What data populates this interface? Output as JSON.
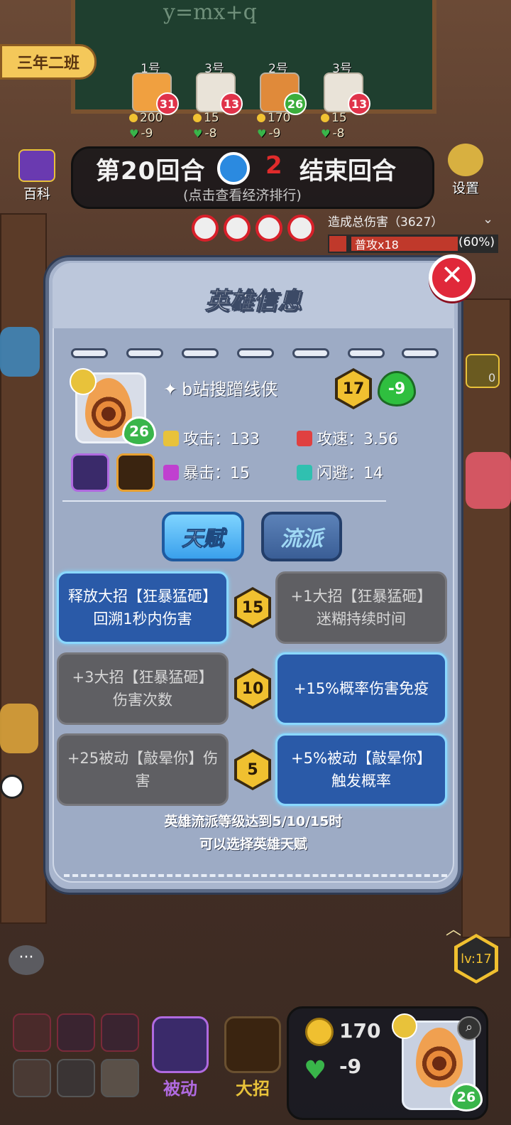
{
  "header": {
    "class_sign": "三年二班",
    "blackboard_text": "y=mx+q"
  },
  "players": [
    {
      "num": "1号",
      "level": "31",
      "gold": "200",
      "hp": "-9"
    },
    {
      "num": "3号",
      "level": "13",
      "gold": "15",
      "hp": "-8"
    },
    {
      "num": "2号",
      "level": "26",
      "gold": "170",
      "hp": "-9"
    },
    {
      "num": "3号",
      "level": "13",
      "gold": "15",
      "hp": "-8"
    }
  ],
  "round_bar": {
    "round_label": "第20回合",
    "countdown": "2",
    "end_label": "结束回合",
    "subtitle": "(点击查看经济排行)"
  },
  "side_buttons": {
    "encyclopedia": "百科",
    "settings": "设置"
  },
  "damage_panel": {
    "title": "造成总伤害（3627）",
    "row_label": "普攻x18",
    "row_pct": "(60%)",
    "right_value": "0"
  },
  "modal": {
    "title": "英雄信息",
    "hero": {
      "name": "b站搜蹭线侠",
      "level": "26",
      "star_level": "17",
      "health": "-9"
    },
    "stats": {
      "attack": "攻击：133",
      "attack_speed": "攻速：3.56",
      "crit": "暴击：15",
      "dodge": "闪避：14"
    },
    "tabs": {
      "talent": "天赋",
      "school": "流派"
    },
    "talents": [
      {
        "level": "15",
        "left": "释放大招【狂暴猛砸】回溯1秒内伤害",
        "right": "+1大招【狂暴猛砸】迷糊持续时间",
        "selected": "left"
      },
      {
        "level": "10",
        "left": "+3大招【狂暴猛砸】伤害次数",
        "right": "+15%概率伤害免疫",
        "selected": "right"
      },
      {
        "level": "5",
        "left": "+25被动【敲晕你】伤害",
        "right": "+5%被动【敲晕你】触发概率",
        "selected": "right"
      }
    ],
    "footnote_line1": "英雄流派等级达到5/10/15时",
    "footnote_line2": "可以选择英雄天赋"
  },
  "bottom": {
    "passive_label": "被动",
    "ultimate_label": "大招",
    "gold": "170",
    "hp": "-9",
    "hero_level": "26",
    "shop_level": "lv:17",
    "chat_icon": "···"
  },
  "colors": {
    "accent_blue": "#2a5aa8",
    "close_red": "#e0283a",
    "gold": "#f0c030",
    "health_green": "#39b54a",
    "passive_purple": "#b06ae0",
    "ultimate_gold": "#e8c23a"
  }
}
